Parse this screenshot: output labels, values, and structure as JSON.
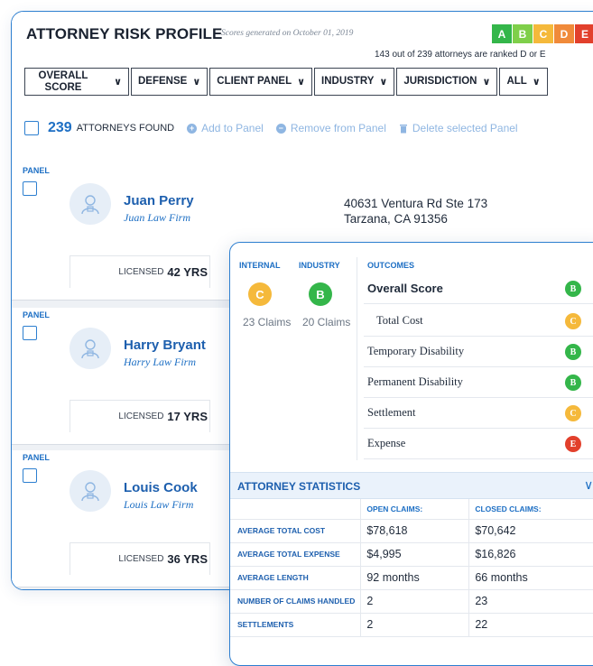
{
  "header": {
    "title": "ATTORNEY RISK PROFILE",
    "subtitle": "Scores generated on October 01, 2019",
    "grades": [
      {
        "letter": "A",
        "color": "#34b64a"
      },
      {
        "letter": "B",
        "color": "#7fcf4a"
      },
      {
        "letter": "C",
        "color": "#f5b93b"
      },
      {
        "letter": "D",
        "color": "#f08a3a"
      },
      {
        "letter": "E",
        "color": "#e2402c"
      }
    ],
    "ranked_note": "143 out of 239 attorneys are ranked D or E"
  },
  "filters": [
    {
      "label": "OVERALL SCORE"
    },
    {
      "label": "DEFENSE"
    },
    {
      "label": "CLIENT PANEL"
    },
    {
      "label": "INDUSTRY"
    },
    {
      "label": "JURISDICTION"
    },
    {
      "label": "ALL"
    }
  ],
  "toolbar": {
    "count": "239",
    "found_label": "ATTORNEYS FOUND",
    "add_label": "Add to Panel",
    "remove_label": "Remove from Panel",
    "delete_label": "Delete selected Panel"
  },
  "attorneys": [
    {
      "panel": "PANEL",
      "name": "Juan Perry",
      "firm": "Juan Law Firm",
      "address1": "40631 Ventura Rd Ste 173",
      "address2": "Tarzana, CA 91356",
      "licensed_label": "LICENSED",
      "years": "42 YRS"
    },
    {
      "panel": "PANEL",
      "name": "Harry Bryant",
      "firm": "Harry Law Firm",
      "licensed_label": "LICENSED",
      "years": "17 YRS"
    },
    {
      "panel": "PANEL",
      "name": "Louis Cook",
      "firm": "Louis Law Firm",
      "licensed_label": "LICENSED",
      "years": "36 YRS"
    }
  ],
  "profile": {
    "internal_label": "INTERNAL",
    "industry_label": "INDUSTRY",
    "outcomes_label": "OUTCOMES",
    "internal_grade": "C",
    "industry_grade": "B",
    "internal_claims": "23 Claims",
    "industry_claims": "20 Claims",
    "outcomes": [
      {
        "label": "Overall Score",
        "grade": "B",
        "color": "#34b64a"
      },
      {
        "label": "Total Cost",
        "grade": "C",
        "color": "#f5b93b"
      },
      {
        "label": "Temporary Disability",
        "grade": "B",
        "color": "#34b64a"
      },
      {
        "label": "Permanent Disability",
        "grade": "B",
        "color": "#34b64a"
      },
      {
        "label": "Settlement",
        "grade": "C",
        "color": "#f5b93b"
      },
      {
        "label": "Expense",
        "grade": "E",
        "color": "#e2402c"
      }
    ]
  },
  "statistics": {
    "title": "ATTORNEY STATISTICS",
    "open_header": "OPEN CLAIMS:",
    "closed_header": "CLOSED CLAIMS:",
    "rows": [
      {
        "label": "AVERAGE TOTAL COST",
        "open": "$78,618",
        "closed": "$70,642"
      },
      {
        "label": "AVERAGE TOTAL EXPENSE",
        "open": "$4,995",
        "closed": "$16,826"
      },
      {
        "label": "AVERAGE LENGTH",
        "open": "92 months",
        "closed": "66 months"
      },
      {
        "label": "NUMBER OF CLAIMS HANDLED",
        "open": "2",
        "closed": "23"
      },
      {
        "label": "SETTLEMENTS",
        "open": "2",
        "closed": "22"
      }
    ]
  }
}
